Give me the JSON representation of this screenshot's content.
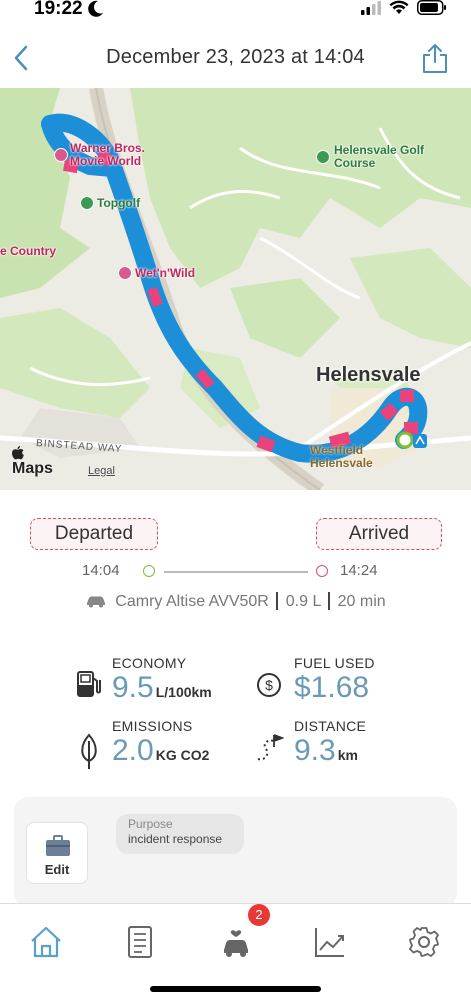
{
  "status_bar": {
    "time": "19:22"
  },
  "header": {
    "title": "December 23, 2023 at 14:04"
  },
  "map": {
    "labels": {
      "warner": "Warner Bros. Movie World",
      "topgolf": "Topgolf",
      "country": "e Country",
      "wetnwild": "Wet'n'Wild",
      "helensvale_golf": "Helensvale Golf Course",
      "helensvale": "Helensvale",
      "westfield": "Westfield Helensvale",
      "binstead": "BINSTEAD WAY"
    },
    "attribution": {
      "maps": "Maps",
      "legal": "Legal"
    },
    "route_color": "#1d8fd8",
    "event_color": "#e8437a"
  },
  "trip": {
    "departed_label": "Departed",
    "arrived_label": "Arrived",
    "departed_time": "14:04",
    "arrived_time": "14:24",
    "vehicle": "Camry Altise AVV50R",
    "fuel": "0.9 L",
    "duration": "20 min"
  },
  "stats": {
    "economy": {
      "label": "ECONOMY",
      "value": "9.5",
      "unit": "L/100km"
    },
    "fuel_used": {
      "label": "FUEL USED",
      "value": "$1.68"
    },
    "emissions": {
      "label": "EMISSIONS",
      "value": "2.0",
      "unit": "KG CO2"
    },
    "distance": {
      "label": "DISTANCE",
      "value": "9.3",
      "unit": "km"
    }
  },
  "purpose": {
    "edit_label": "Edit",
    "label": "Purpose",
    "value": "incident response"
  },
  "tab_bar": {
    "vehicle_badge": "2"
  }
}
